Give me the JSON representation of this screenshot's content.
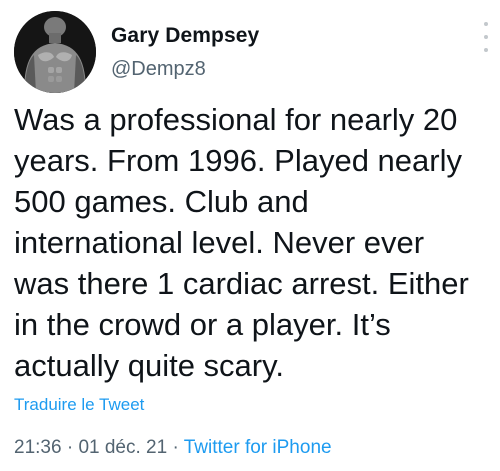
{
  "author": {
    "name": "Gary Dempsey",
    "handle": "@Dempz8",
    "avatar": "avatar-photo"
  },
  "menu_icon": "more-vertical-icon",
  "tweet": {
    "text": "Was a professional for nearly 20\nyears. From 1996. Played nearly\n500 games. Club and\ninternational level. Never ever\nwas there 1 cardiac arrest. Either\nin the crowd or a player. It’s\nactually quite scary.",
    "translate_label": "Traduire le Tweet"
  },
  "meta": {
    "time": "21:36",
    "separator1": " · ",
    "date": "01 déc. 21",
    "separator2": " · ",
    "source": "Twitter for iPhone"
  },
  "colors": {
    "text": "#0f1419",
    "secondary": "#536471",
    "link": "#1d9bf0"
  }
}
